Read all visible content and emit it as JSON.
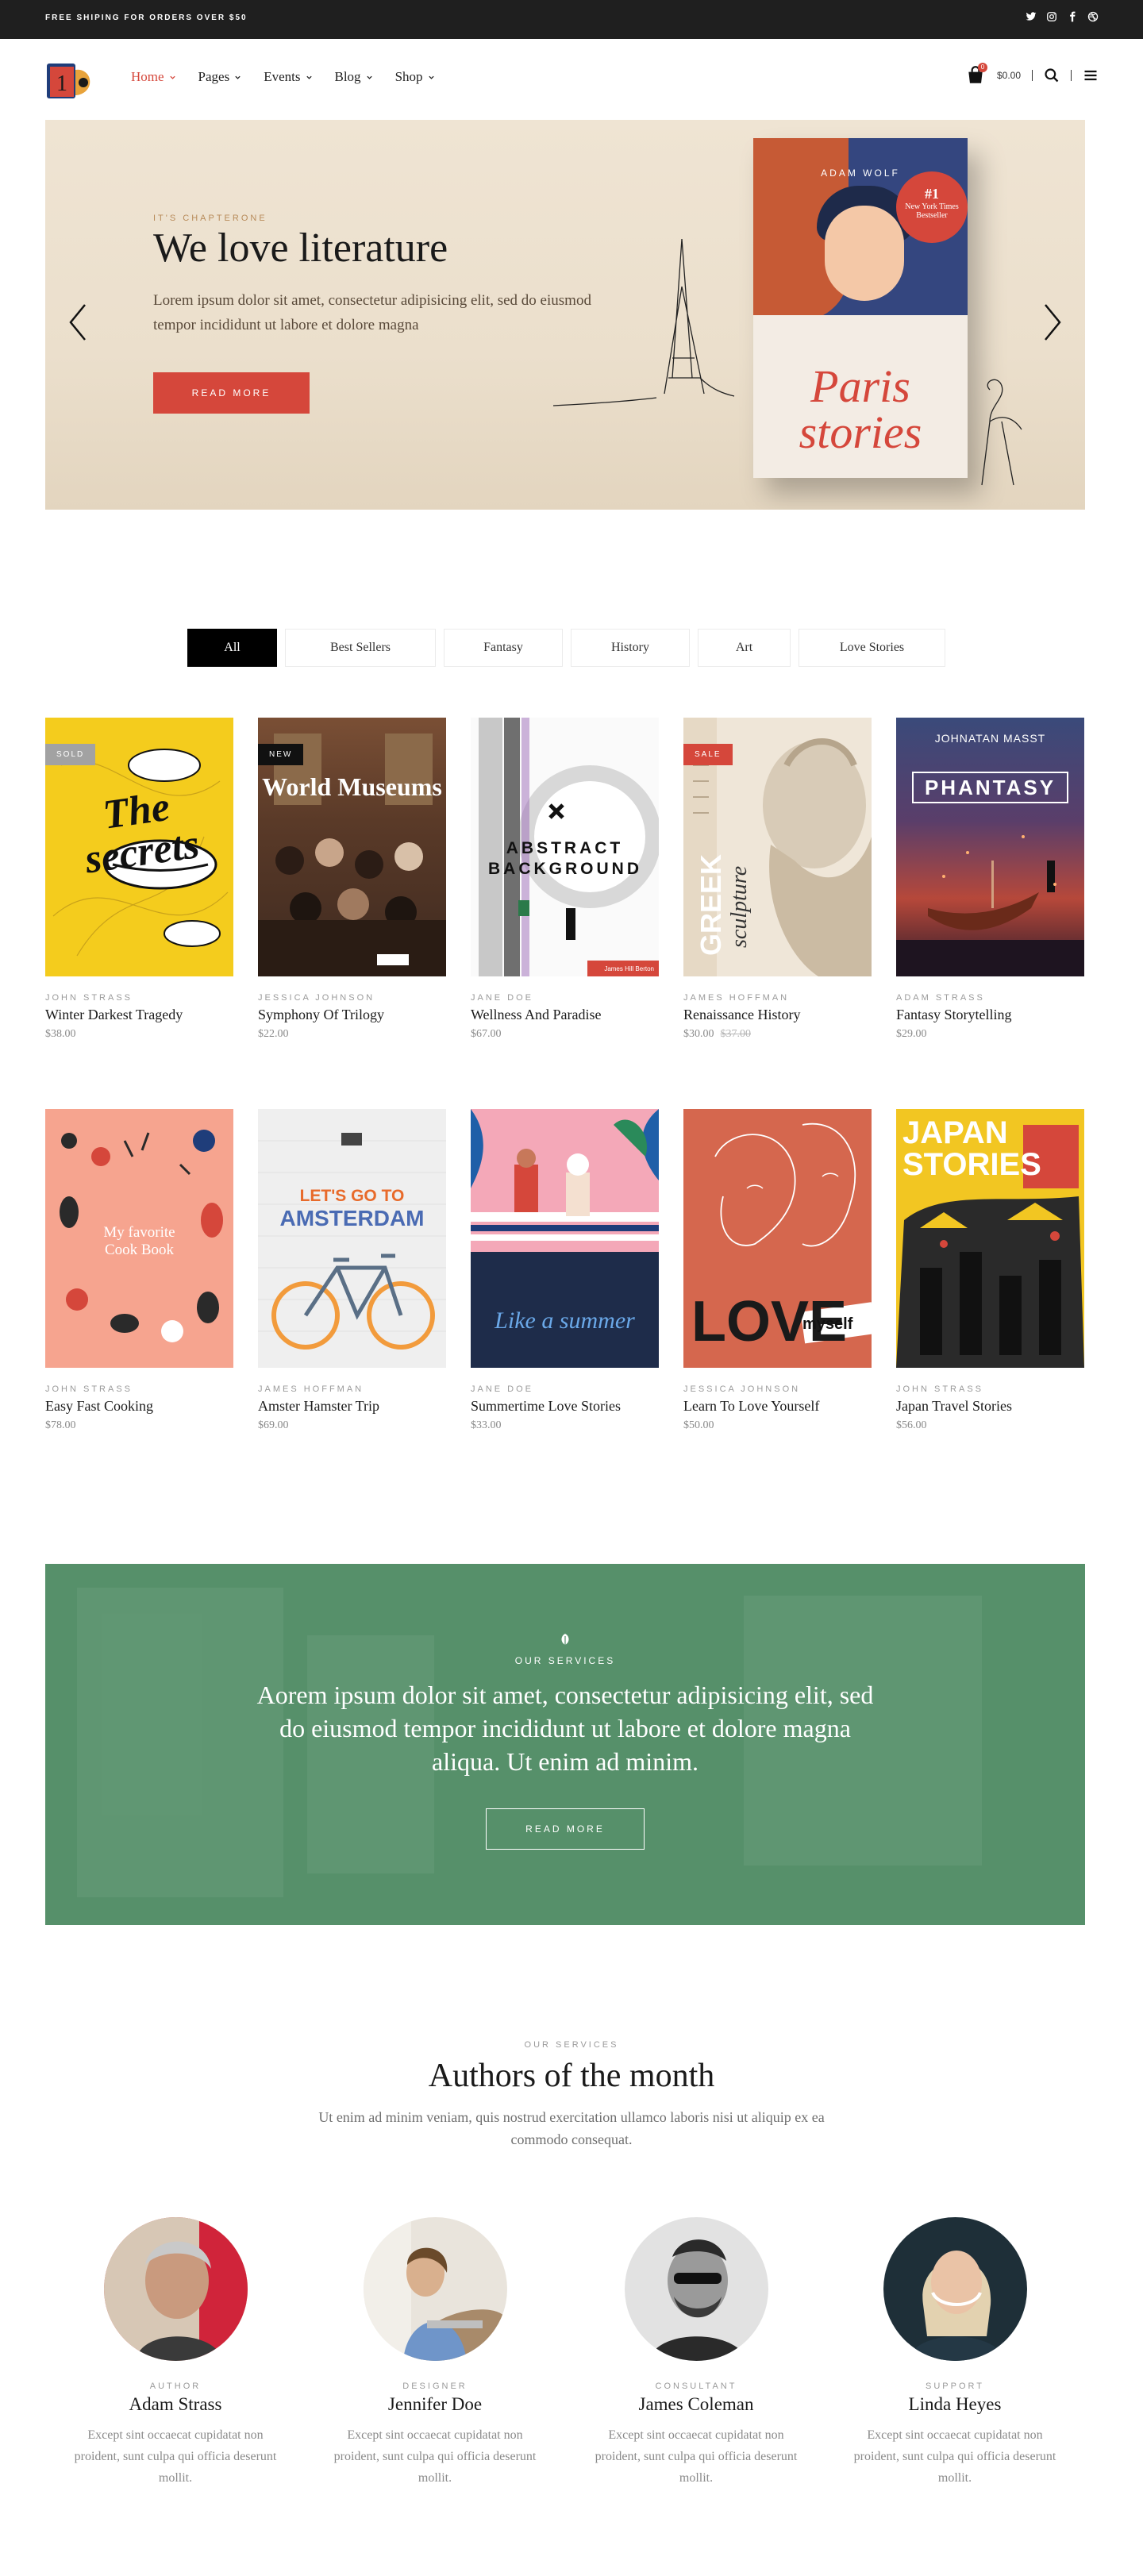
{
  "topbar": {
    "shipping": "FREE SHIPING FOR ORDERS OVER $50",
    "social": [
      "twitter-icon",
      "instagram-icon",
      "facebook-icon",
      "dribbble-icon"
    ]
  },
  "header": {
    "nav": [
      {
        "label": "Home",
        "active": true
      },
      {
        "label": "Pages"
      },
      {
        "label": "Events"
      },
      {
        "label": "Blog"
      },
      {
        "label": "Shop"
      }
    ],
    "cart_count": "0",
    "cart_total": "$0.00"
  },
  "hero": {
    "eyebrow": "IT'S CHAPTERONE",
    "title": "We love literature",
    "description": "Lorem ipsum dolor sit amet, consectetur adipisicing elit, sed do eiusmod tempor incididunt ut labore et dolore magna",
    "button": "READ MORE",
    "book": {
      "author": "ADAM WOLF",
      "seal_number": "#1",
      "seal_text": "New York Times Bestseller",
      "title": "Paris stories"
    }
  },
  "filters": [
    "All",
    "Best Sellers",
    "Fantasy",
    "History",
    "Art",
    "Love Stories"
  ],
  "products": [
    {
      "author": "JOHN STRASS",
      "name": "Winter Darkest Tragedy",
      "price": "$38.00",
      "tag": "SOLD",
      "cover_text": "The secrets"
    },
    {
      "author": "JESSICA JOHNSON",
      "name": "Symphony Of Trilogy",
      "price": "$22.00",
      "tag": "NEW",
      "cover_text": "World Museums"
    },
    {
      "author": "JANE DOE",
      "name": "Wellness And Paradise",
      "price": "$67.00",
      "cover_text": "ABSTRACT BACKGROUND",
      "cover_sub": "James Hill Berton"
    },
    {
      "author": "JAMES HOFFMAN",
      "name": "Renaissance History",
      "price": "$30.00",
      "old_price": "$37.00",
      "tag": "SALE",
      "cover_text": "GREEK",
      "cover_sub": "sculpture"
    },
    {
      "author": "ADAM STRASS",
      "name": "Fantasy Storytelling",
      "price": "$29.00",
      "cover_text": "PHANTASY",
      "cover_sub": "JOHNATAN MASST"
    },
    {
      "author": "JOHN STRASS",
      "name": "Easy Fast Cooking",
      "price": "$78.00",
      "cover_text": "My favorite Cook Book"
    },
    {
      "author": "JAMES HOFFMAN",
      "name": "Amster Hamster Trip",
      "price": "$69.00",
      "cover_text": "LET'S GO TO",
      "cover_sub": "AMSTERDAM"
    },
    {
      "author": "JANE DOE",
      "name": "Summertime Love Stories",
      "price": "$33.00",
      "cover_text": "Like a summer"
    },
    {
      "author": "JESSICA JOHNSON",
      "name": "Learn To Love Yourself",
      "price": "$50.00",
      "cover_text": "LOVE",
      "cover_sub": "myself"
    },
    {
      "author": "JOHN STRASS",
      "name": "Japan Travel Stories",
      "price": "$56.00",
      "cover_text": "JAPAN STORIES"
    }
  ],
  "services": {
    "eyebrow": "OUR SERVICES",
    "text": "Aorem ipsum dolor sit amet, consectetur adipisicing elit, sed do eiusmod tempor incididunt ut labore et dolore magna aliqua. Ut enim ad minim.",
    "button": "READ MORE"
  },
  "authors": {
    "eyebrow": "OUR SERVICES",
    "title": "Authors of the month",
    "description": "Ut enim ad minim veniam, quis nostrud exercitation ullamco laboris nisi ut aliquip ex ea commodo consequat.",
    "people": [
      {
        "role": "AUTHOR",
        "name": "Adam Strass",
        "text": "Except sint occaecat cupidatat non proident, sunt culpa qui officia deserunt mollit."
      },
      {
        "role": "DESIGNER",
        "name": "Jennifer Doe",
        "text": "Except sint occaecat cupidatat non proident, sunt culpa qui officia deserunt mollit."
      },
      {
        "role": "CONSULTANT",
        "name": "James Coleman",
        "text": "Except sint occaecat cupidatat non proident, sunt culpa qui officia deserunt mollit."
      },
      {
        "role": "SUPPORT",
        "name": "Linda Heyes",
        "text": "Except sint occaecat cupidatat non proident, sunt culpa qui officia deserunt mollit."
      }
    ]
  },
  "colors": {
    "accent": "#d5473b",
    "services_bg": "#56906a",
    "topbar": "#1f1f1f"
  }
}
